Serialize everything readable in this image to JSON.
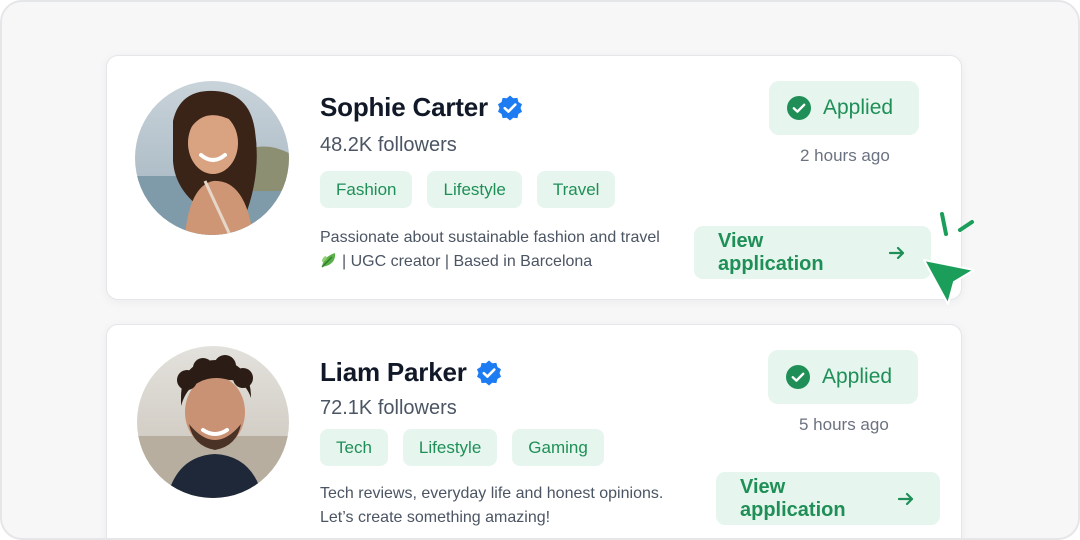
{
  "colors": {
    "accent": "#1f8f57",
    "accent_bg": "#e6f6ee",
    "verified_blue": "#1d7cf2",
    "text_dark": "#111827",
    "text_muted": "#4b5563"
  },
  "applicants": [
    {
      "name": "Sophie Carter",
      "followers": "48.2K followers",
      "tags": [
        "Fashion",
        "Lifestyle",
        "Travel"
      ],
      "bio_line1": "Passionate about sustainable fashion and travel",
      "bio_line2": "| UGC creator | Based in Barcelona",
      "status": "Applied",
      "time": "2 hours ago",
      "action": "View application",
      "icons": [
        "verified-badge-icon",
        "check-circle-icon",
        "leaf-icon",
        "arrow-right-icon"
      ]
    },
    {
      "name": "Liam Parker",
      "followers": "72.1K followers",
      "tags": [
        "Tech",
        "Lifestyle",
        "Gaming"
      ],
      "bio_line1": "Tech reviews, everyday life and honest opinions.",
      "bio_line2": "Let’s create something amazing!",
      "status": "Applied",
      "time": "5 hours ago",
      "action": "View application",
      "icons": [
        "verified-badge-icon",
        "check-circle-icon",
        "arrow-right-icon"
      ]
    }
  ],
  "pointer": {
    "icon": "cursor-pointer-icon"
  }
}
